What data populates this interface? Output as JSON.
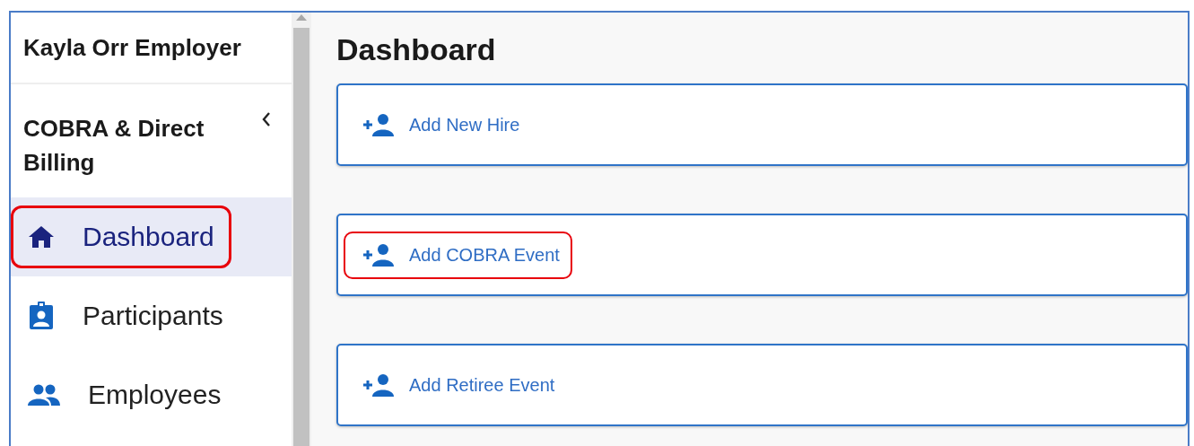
{
  "sidebar": {
    "account_name": "Kayla Orr Employer",
    "section_title": "COBRA & Direct Billing",
    "items": [
      {
        "label": "Dashboard",
        "kind": "home",
        "selected": true,
        "highlighted": true
      },
      {
        "label": "Participants",
        "kind": "badge",
        "selected": false,
        "highlighted": false
      },
      {
        "label": "Employees",
        "kind": "people",
        "selected": false,
        "highlighted": false
      }
    ]
  },
  "main": {
    "title": "Dashboard",
    "actions": [
      {
        "label": "Add New Hire",
        "highlighted": false
      },
      {
        "label": "Add COBRA Event",
        "highlighted": true
      },
      {
        "label": "Add Retiree Event",
        "highlighted": false
      }
    ]
  }
}
